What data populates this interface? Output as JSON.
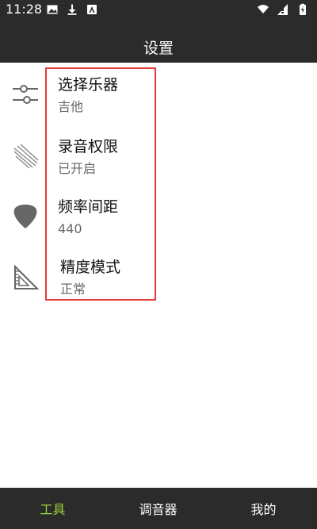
{
  "status_bar": {
    "time": "11:28",
    "left_icons": [
      "image-icon",
      "download-icon",
      "a-box-icon"
    ],
    "right_icons": [
      "wifi-icon",
      "signal-icon",
      "battery-icon"
    ]
  },
  "app_bar": {
    "title": "设置"
  },
  "sidebar": {
    "icons": [
      "sliders-icon",
      "lines-icon",
      "guitar-pick-icon",
      "triangle-ruler-icon"
    ]
  },
  "settings": {
    "items": [
      {
        "title": "选择乐器",
        "value": "吉他"
      },
      {
        "title": "录音权限",
        "value": "已开启"
      },
      {
        "title": "频率间距",
        "value": "440"
      },
      {
        "title": "精度模式",
        "value": "正常"
      }
    ]
  },
  "bottom_nav": {
    "tabs": [
      {
        "label": "工具",
        "active": true
      },
      {
        "label": "调音器",
        "active": false
      },
      {
        "label": "我的",
        "active": false
      }
    ],
    "active_color": "#9bd23c"
  },
  "colors": {
    "bar_bg": "#2b2b2b",
    "highlight_border": "#e53935"
  }
}
